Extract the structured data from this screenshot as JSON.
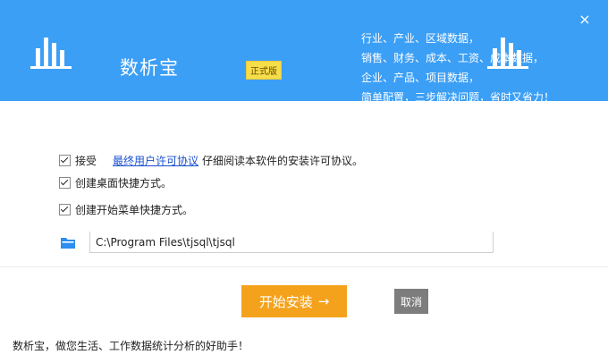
{
  "header": {
    "app_name": "数析宝",
    "edition": "正式版",
    "close_glyph": "×",
    "slogan": [
      "行业、产业、区域数据，",
      "销售、财务、成本、工资、成本数据，",
      "企业、产品、项目数据，",
      "简单配置，三步解决问题，省时又省力！"
    ]
  },
  "options": {
    "accept_prefix": "接受",
    "license_link": "最终用户许可协议",
    "accept_suffix": "仔细阅读本软件的安装许可协议。",
    "desktop_shortcut": "创建桌面快捷方式。",
    "start_menu_shortcut": "创建开始菜单快捷方式。"
  },
  "install_path": {
    "value": "C:\\Program Files\\tjsql\\tjsql"
  },
  "buttons": {
    "install": "开始安装",
    "install_arrow": "→",
    "cancel": "取消"
  },
  "footer": {
    "tagline": "数析宝，做您生活、工作数据统计分析的好助手！"
  },
  "colors": {
    "header_bg": "#3c9ff6",
    "install_bg": "#f4a21c",
    "cancel_bg": "#7d7d7d",
    "badge_bg": "#f6dd4a"
  }
}
